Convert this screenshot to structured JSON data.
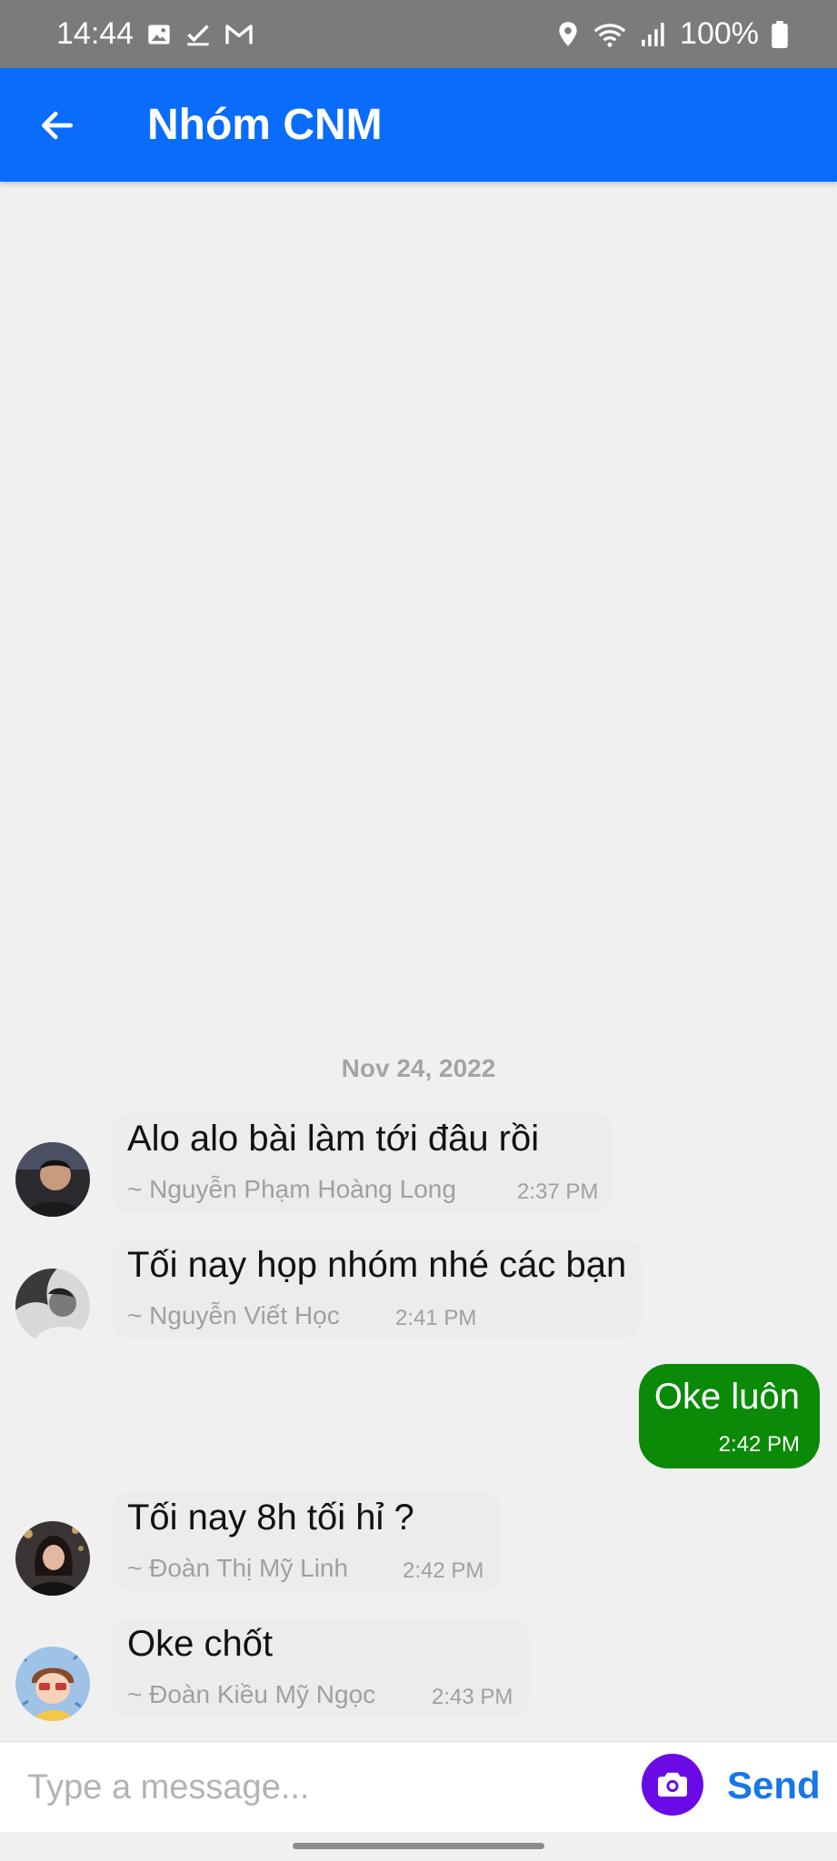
{
  "status_bar": {
    "time": "14:44",
    "battery": "100%",
    "icons": [
      "image-icon",
      "check-icon",
      "gmail-icon",
      "location-icon",
      "wifi-icon",
      "signal-icon",
      "battery-icon"
    ]
  },
  "header": {
    "title": "Nhóm CNM",
    "back_icon": "arrow-left-icon",
    "color": "#0a6cfb"
  },
  "chat": {
    "date_separator": "Nov 24, 2022",
    "messages": [
      {
        "direction": "incoming",
        "text": "Alo alo bài làm tới đâu rồi",
        "sender": "~ Nguyễn Phạm Hoàng Long",
        "time": "2:37 PM"
      },
      {
        "direction": "incoming",
        "text": "Tối nay họp nhóm nhé các bạn",
        "sender": "~ Nguyễn Viết Học",
        "time": "2:41 PM"
      },
      {
        "direction": "outgoing",
        "text": "Oke luôn",
        "time": "2:42 PM"
      },
      {
        "direction": "incoming",
        "text": "Tối nay 8h tối hỉ ?",
        "sender": "~ Đoàn Thị Mỹ Linh",
        "time": "2:42 PM"
      },
      {
        "direction": "incoming",
        "text": "Oke chốt",
        "sender": "~ Đoàn Kiều Mỹ Ngọc",
        "time": "2:43 PM"
      }
    ],
    "outgoing_color": "#0a8a06"
  },
  "composer": {
    "placeholder": "Type a message...",
    "send_label": "Send",
    "camera_icon": "camera-icon",
    "camera_color": "#6a0ae6",
    "send_color": "#1677e8"
  }
}
